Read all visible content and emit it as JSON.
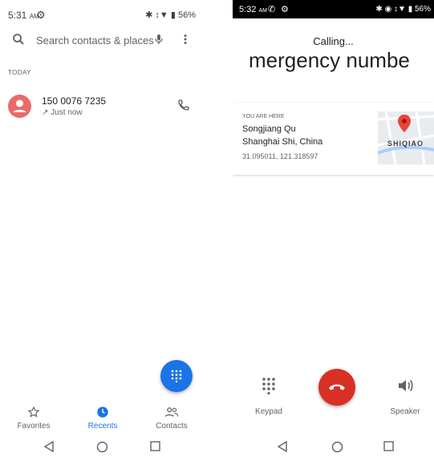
{
  "left": {
    "status": {
      "time": "5:31",
      "ampm": "AM",
      "battery": "56%"
    },
    "search": {
      "placeholder": "Search contacts & places"
    },
    "section_label": "TODAY",
    "calls": [
      {
        "number": "150 0076 7235",
        "time": "Just now",
        "direction": "outgoing"
      }
    ],
    "nav": {
      "favorites": "Favorites",
      "recents": "Recents",
      "contacts": "Contacts",
      "active": "recents"
    },
    "accent_color": "#1a73e8"
  },
  "right": {
    "status": {
      "time": "5:32",
      "ampm": "AM",
      "battery": "56%"
    },
    "calling_label": "Calling...",
    "callee": "mergency numbe",
    "location": {
      "header": "YOU ARE HERE",
      "line1": "Songjiang Qu",
      "line2": "Shanghai Shi, China",
      "coords": "31.095011, 121.318597",
      "map_text": "SHIQIAO"
    },
    "controls": {
      "keypad": "Keypad",
      "speaker": "Speaker"
    },
    "end_call_color": "#d93025"
  }
}
